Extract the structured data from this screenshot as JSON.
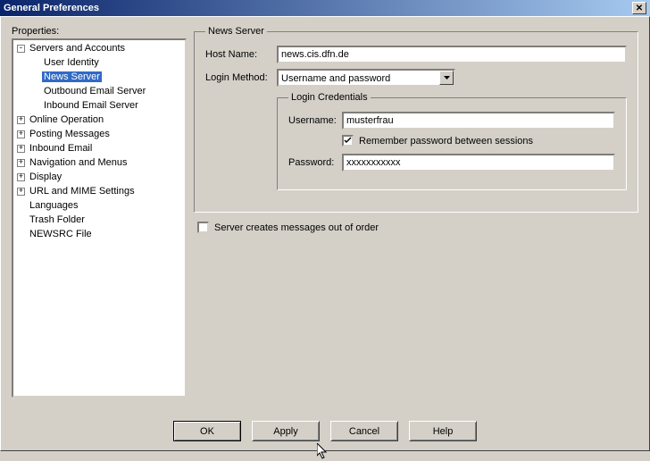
{
  "window": {
    "title": "General Preferences"
  },
  "left": {
    "label": "Properties:",
    "tree": {
      "root_label": "Servers and Accounts",
      "root_children": [
        "User Identity",
        "News Server",
        "Outbound Email Server",
        "Inbound Email Server"
      ],
      "selected_index": 1,
      "siblings": [
        "Online Operation",
        "Posting Messages",
        "Inbound Email",
        "Navigation and Menus",
        "Display",
        "URL and MIME Settings",
        "Languages",
        "Trash Folder",
        "NEWSRC File"
      ]
    }
  },
  "panel": {
    "legend": "News Server",
    "host_label": "Host Name:",
    "host_value": "news.cis.dfn.de",
    "login_method_label": "Login Method:",
    "login_method_value": "Username and password",
    "creds_legend": "Login Credentials",
    "username_label": "Username:",
    "username_value": "musterfrau",
    "remember_label": "Remember password between sessions",
    "remember_checked": true,
    "password_label": "Password:",
    "password_value": "xxxxxxxxxxx",
    "out_of_order_label": "Server creates messages out of order",
    "out_of_order_checked": false
  },
  "buttons": {
    "ok": "OK",
    "apply": "Apply",
    "cancel": "Cancel",
    "help": "Help"
  }
}
